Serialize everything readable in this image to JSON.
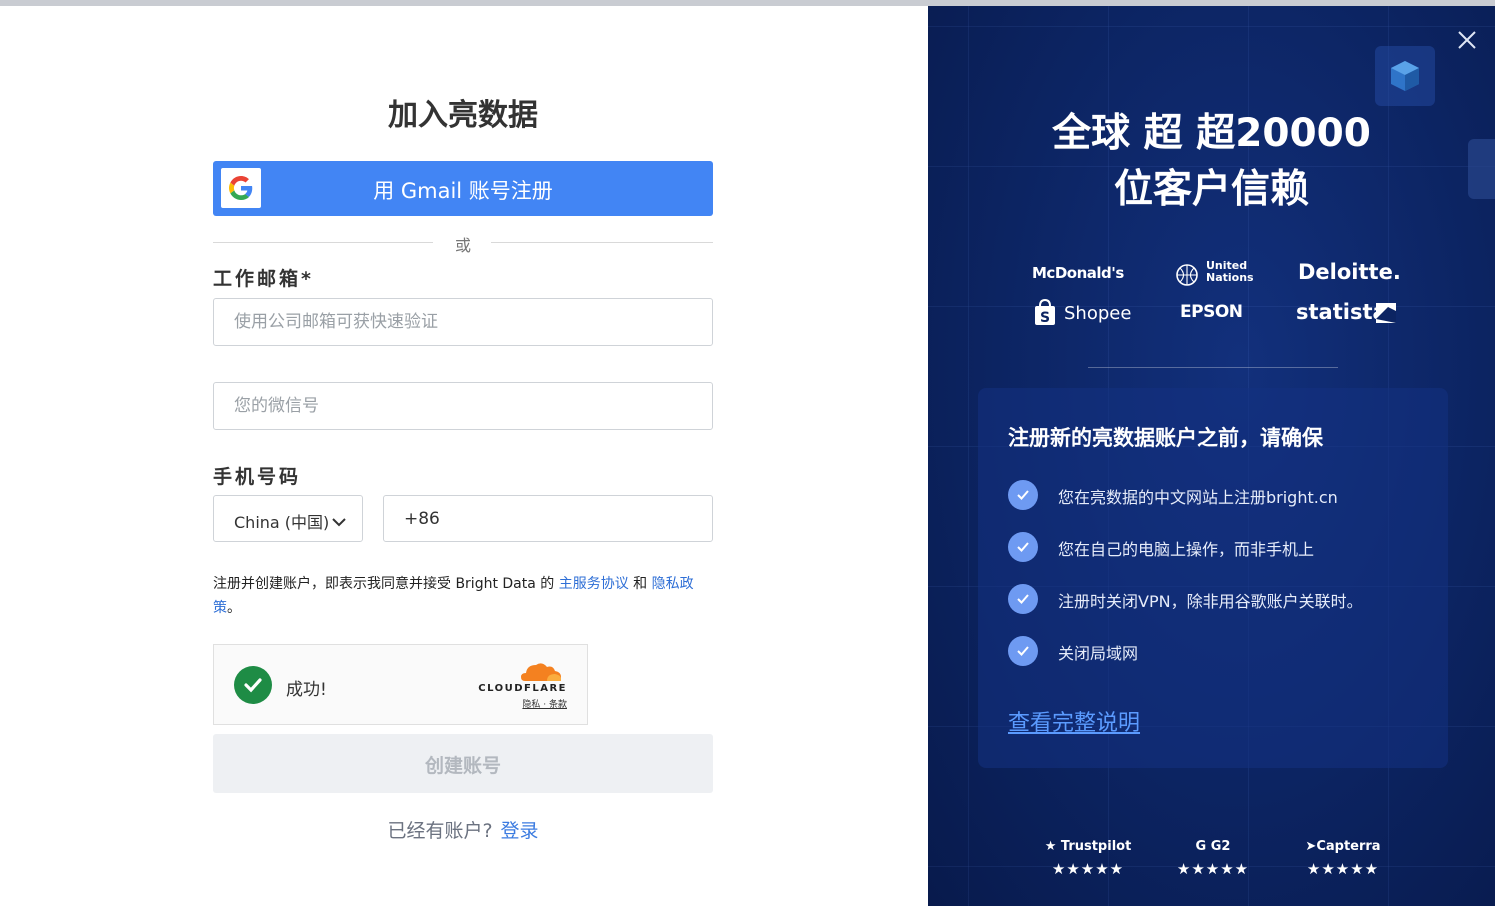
{
  "left": {
    "title": "加入亮数据",
    "gmail_button": "用 Gmail 账号注册",
    "divider_text": "或",
    "email": {
      "label": "工作邮箱*",
      "placeholder": "使用公司邮箱可获快速验证"
    },
    "wechat": {
      "placeholder": "您的微信号"
    },
    "phone": {
      "label": "手机号码",
      "country": "China (中国)",
      "value": "+86"
    },
    "terms": {
      "prefix": "注册并创建账户，即表示我同意并接受 Bright Data 的 ",
      "link_service": "主服务协议",
      "middle": " 和 ",
      "link_privacy": "隐私政策",
      "suffix": "。"
    },
    "captcha": {
      "status": "成功!",
      "provider": "CLOUDFLARE",
      "links": "隐私 · 条款"
    },
    "create_button": "创建账号",
    "login": {
      "question": "已经有账户?",
      "link": "登录"
    }
  },
  "right": {
    "headline_line1": "全球 超 超20000",
    "headline_line2": "位客户信赖",
    "brands": [
      "McDonald's",
      "United Nations",
      "Deloitte.",
      "Shopee",
      "EPSON",
      "statista"
    ],
    "card": {
      "title": "注册新的亮数据账户之前，请确保",
      "items": [
        "您在亮数据的中文网站上注册bright.cn",
        "您在自己的电脑上操作，而非手机上",
        "注册时关闭VPN，除非用谷歌账户关联时。",
        "关闭局域网"
      ],
      "link": "查看完整说明"
    },
    "ratings": [
      {
        "name": "Trustpilot",
        "stars": 4.5
      },
      {
        "name": "G2",
        "stars": 4.5
      },
      {
        "name": "Capterra",
        "stars": 5
      }
    ]
  },
  "colors": {
    "primary": "#4285f4",
    "panel": "#0c2462",
    "check": "#6e9af2",
    "link": "#2f6fd6"
  }
}
